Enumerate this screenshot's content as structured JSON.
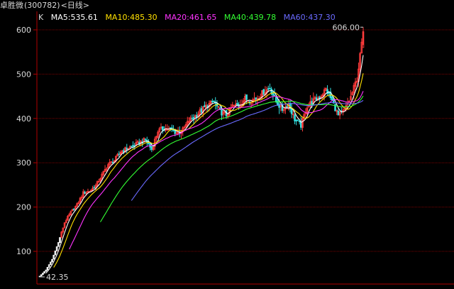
{
  "header": {
    "stock_name": "卓胜微",
    "stock_code": "(300782)",
    "period": "<日线>"
  },
  "legend": {
    "k_label": "K",
    "ma5": "MA5:535.61",
    "ma10": "MA10:485.30",
    "ma20": "MA20:461.65",
    "ma40": "MA40:439.78",
    "ma60": "MA60:437.30"
  },
  "colors": {
    "background": "#000000",
    "up": "#ff3b3b",
    "down": "#33e0e0",
    "ma5": "#ffffff",
    "ma10": "#ffe000",
    "ma20": "#ff33ff",
    "ma40": "#33ff33",
    "ma60": "#6a6aff",
    "grid": "#7a0000",
    "axis": "#b00000",
    "text": "#d8d8d8"
  },
  "annotations": {
    "high_label": "606.00",
    "low_label": "42.35"
  },
  "chart_data": {
    "type": "candlestick",
    "y_ticks": [
      "600",
      "500",
      "400",
      "300",
      "200",
      "100"
    ],
    "ylim": [
      39,
      613
    ],
    "grid": true,
    "high": 606.0,
    "low": 42.35,
    "ma": {
      "ma5": 535.61,
      "ma10": 485.3,
      "ma20": 461.65,
      "ma40": 439.78,
      "ma60": 437.3
    },
    "close_anchors": [
      [
        0,
        44
      ],
      [
        4,
        58
      ],
      [
        8,
        82
      ],
      [
        12,
        120
      ],
      [
        16,
        165
      ],
      [
        20,
        188
      ],
      [
        24,
        205
      ],
      [
        28,
        232
      ],
      [
        32,
        236
      ],
      [
        36,
        248
      ],
      [
        40,
        272
      ],
      [
        44,
        296
      ],
      [
        48,
        305
      ],
      [
        52,
        325
      ],
      [
        56,
        332
      ],
      [
        60,
        338
      ],
      [
        64,
        345
      ],
      [
        68,
        352
      ],
      [
        72,
        330
      ],
      [
        76,
        372
      ],
      [
        80,
        378
      ],
      [
        84,
        375
      ],
      [
        88,
        368
      ],
      [
        92,
        374
      ],
      [
        96,
        395
      ],
      [
        100,
        405
      ],
      [
        104,
        418
      ],
      [
        108,
        430
      ],
      [
        112,
        438
      ],
      [
        116,
        415
      ],
      [
        120,
        408
      ],
      [
        124,
        428
      ],
      [
        128,
        430
      ],
      [
        132,
        445
      ],
      [
        136,
        440
      ],
      [
        140,
        447
      ],
      [
        144,
        460
      ],
      [
        148,
        470
      ],
      [
        152,
        438
      ],
      [
        156,
        420
      ],
      [
        160,
        432
      ],
      [
        164,
        398
      ],
      [
        168,
        384
      ],
      [
        172,
        428
      ],
      [
        176,
        440
      ],
      [
        180,
        448
      ],
      [
        184,
        466
      ],
      [
        188,
        440
      ],
      [
        192,
        406
      ],
      [
        196,
        418
      ],
      [
        200,
        448
      ],
      [
        204,
        490
      ],
      [
        206,
        540
      ],
      [
        208,
        600
      ]
    ]
  }
}
